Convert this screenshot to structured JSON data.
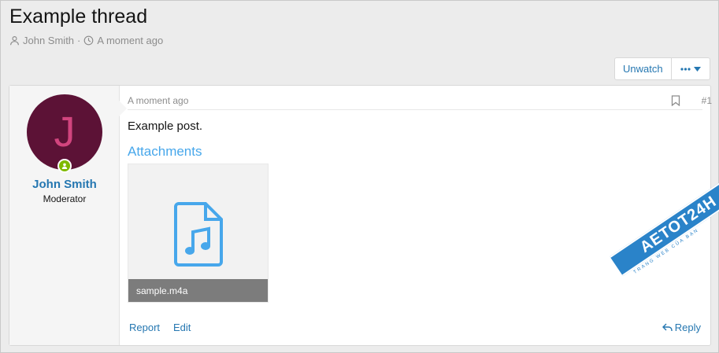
{
  "thread": {
    "title": "Example thread",
    "author": "John Smith",
    "separator": "·",
    "time": "A moment ago"
  },
  "actions": {
    "unwatch_label": "Unwatch",
    "more_icon": "ellipsis-icon",
    "more_caret": "chevron-down-icon"
  },
  "post": {
    "user": {
      "avatar_letter": "J",
      "avatar_bg": "#5c1236",
      "avatar_fg": "#d1457e",
      "name": "John Smith",
      "title": "Moderator",
      "online_color": "#7fb900"
    },
    "date": "A moment ago",
    "number": "#1",
    "body": "Example post.",
    "attachments_heading": "Attachments",
    "attachment": {
      "icon": "audio-file-icon",
      "filename": "sample.m4a"
    },
    "footer": {
      "report_label": "Report",
      "edit_label": "Edit",
      "reply_label": "Reply"
    }
  },
  "watermark": {
    "text": "AETOT24H",
    "sub": "TRANG WEB CỦA BẠN"
  },
  "colors": {
    "link": "#2577b1",
    "accent": "#47a7eb",
    "muted": "#8c8c8c",
    "page_bg": "#ececec"
  }
}
